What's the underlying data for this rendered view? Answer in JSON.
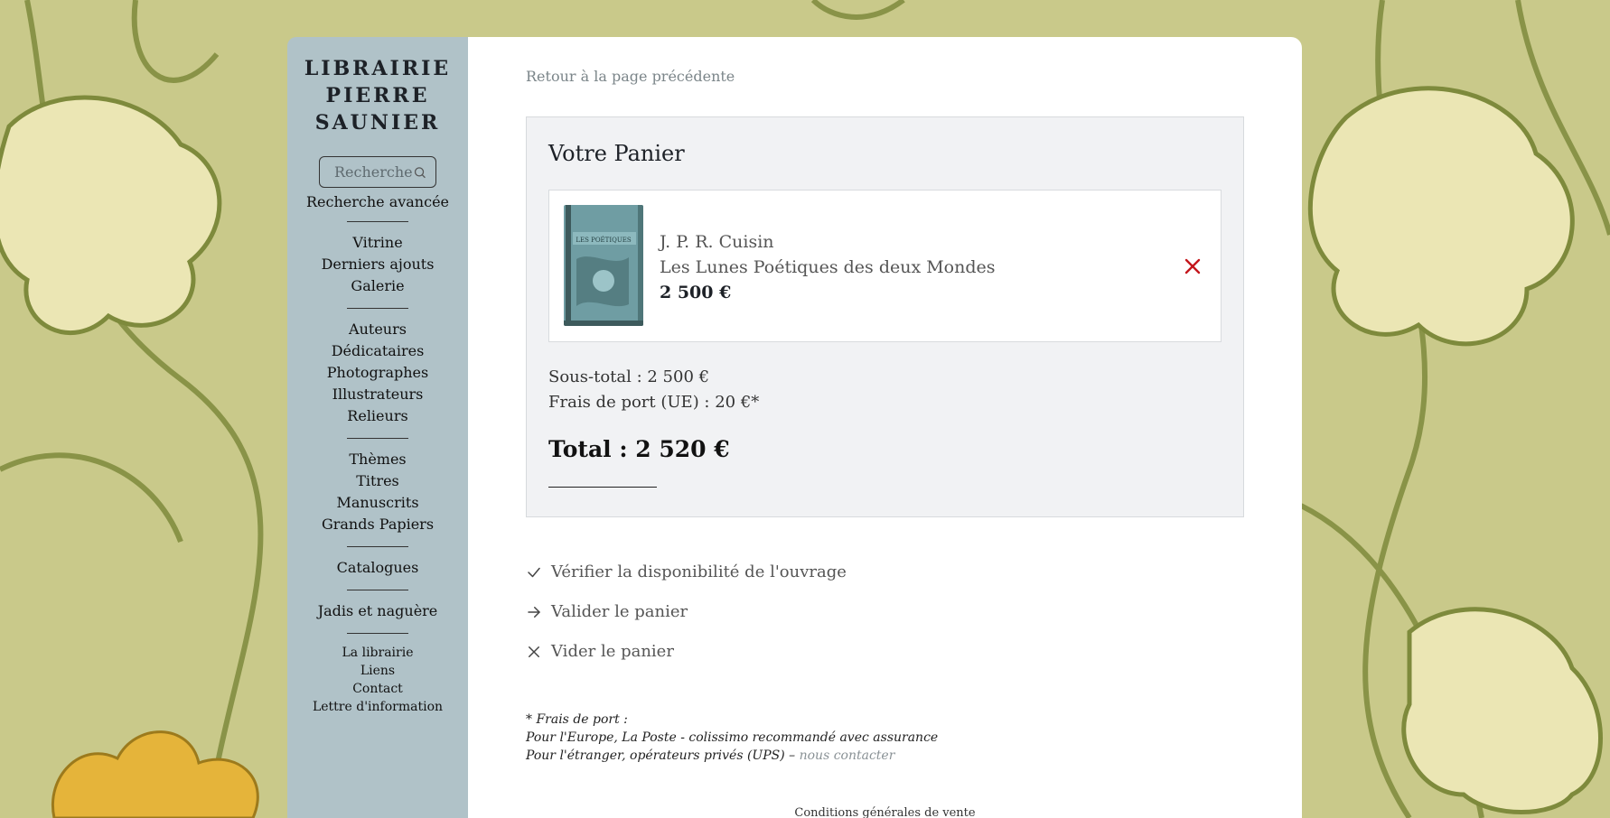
{
  "brand": {
    "lines": [
      "LIBRAIRIE",
      "PIERRE",
      "SAUNIER"
    ]
  },
  "search": {
    "placeholder": "Recherche",
    "advanced_label": "Recherche avancée"
  },
  "nav": {
    "group1": [
      "Vitrine",
      "Derniers ajouts",
      "Galerie"
    ],
    "group2": [
      "Auteurs",
      "Dédicataires",
      "Photographes",
      "Illustrateurs",
      "Relieurs"
    ],
    "group3": [
      "Thèmes",
      "Titres",
      "Manuscrits",
      "Grands Papiers"
    ],
    "group4": [
      "Catalogues"
    ],
    "group5": [
      "Jadis et naguère"
    ],
    "group6": [
      "La librairie",
      "Liens",
      "Contact",
      "Lettre d'information"
    ]
  },
  "main": {
    "back_link": "Retour à la page précédente",
    "cart": {
      "title": "Votre Panier",
      "item": {
        "author": "J. P. R. Cuisin",
        "title": "Les Lunes Poétiques des deux Mondes",
        "price": "2 500 €",
        "cover_text": "LES POÉTIQUES"
      },
      "subtotal": "Sous-total : 2 500 €",
      "shipping": "Frais de port (UE) : 20 €*",
      "total": "Total : 2 520 €"
    },
    "actions": {
      "check": "Vérifier la disponibilité de l'ouvrage",
      "validate": "Valider le panier",
      "empty": "Vider le panier"
    },
    "footnote": {
      "line1": "* Frais de port :",
      "line2": "Pour l'Europe, La Poste - colissimo recommandé avec assurance",
      "line3": "Pour l'étranger, opérateurs privés (UPS) – ",
      "contact": "nous contacter"
    },
    "footer": "Conditions générales de vente"
  },
  "colors": {
    "sidebar_bg": "#b0c2c8",
    "panel_bg": "#f1f2f4",
    "remove_red": "#c4161c",
    "wallpaper_base": "#c9c98a"
  }
}
